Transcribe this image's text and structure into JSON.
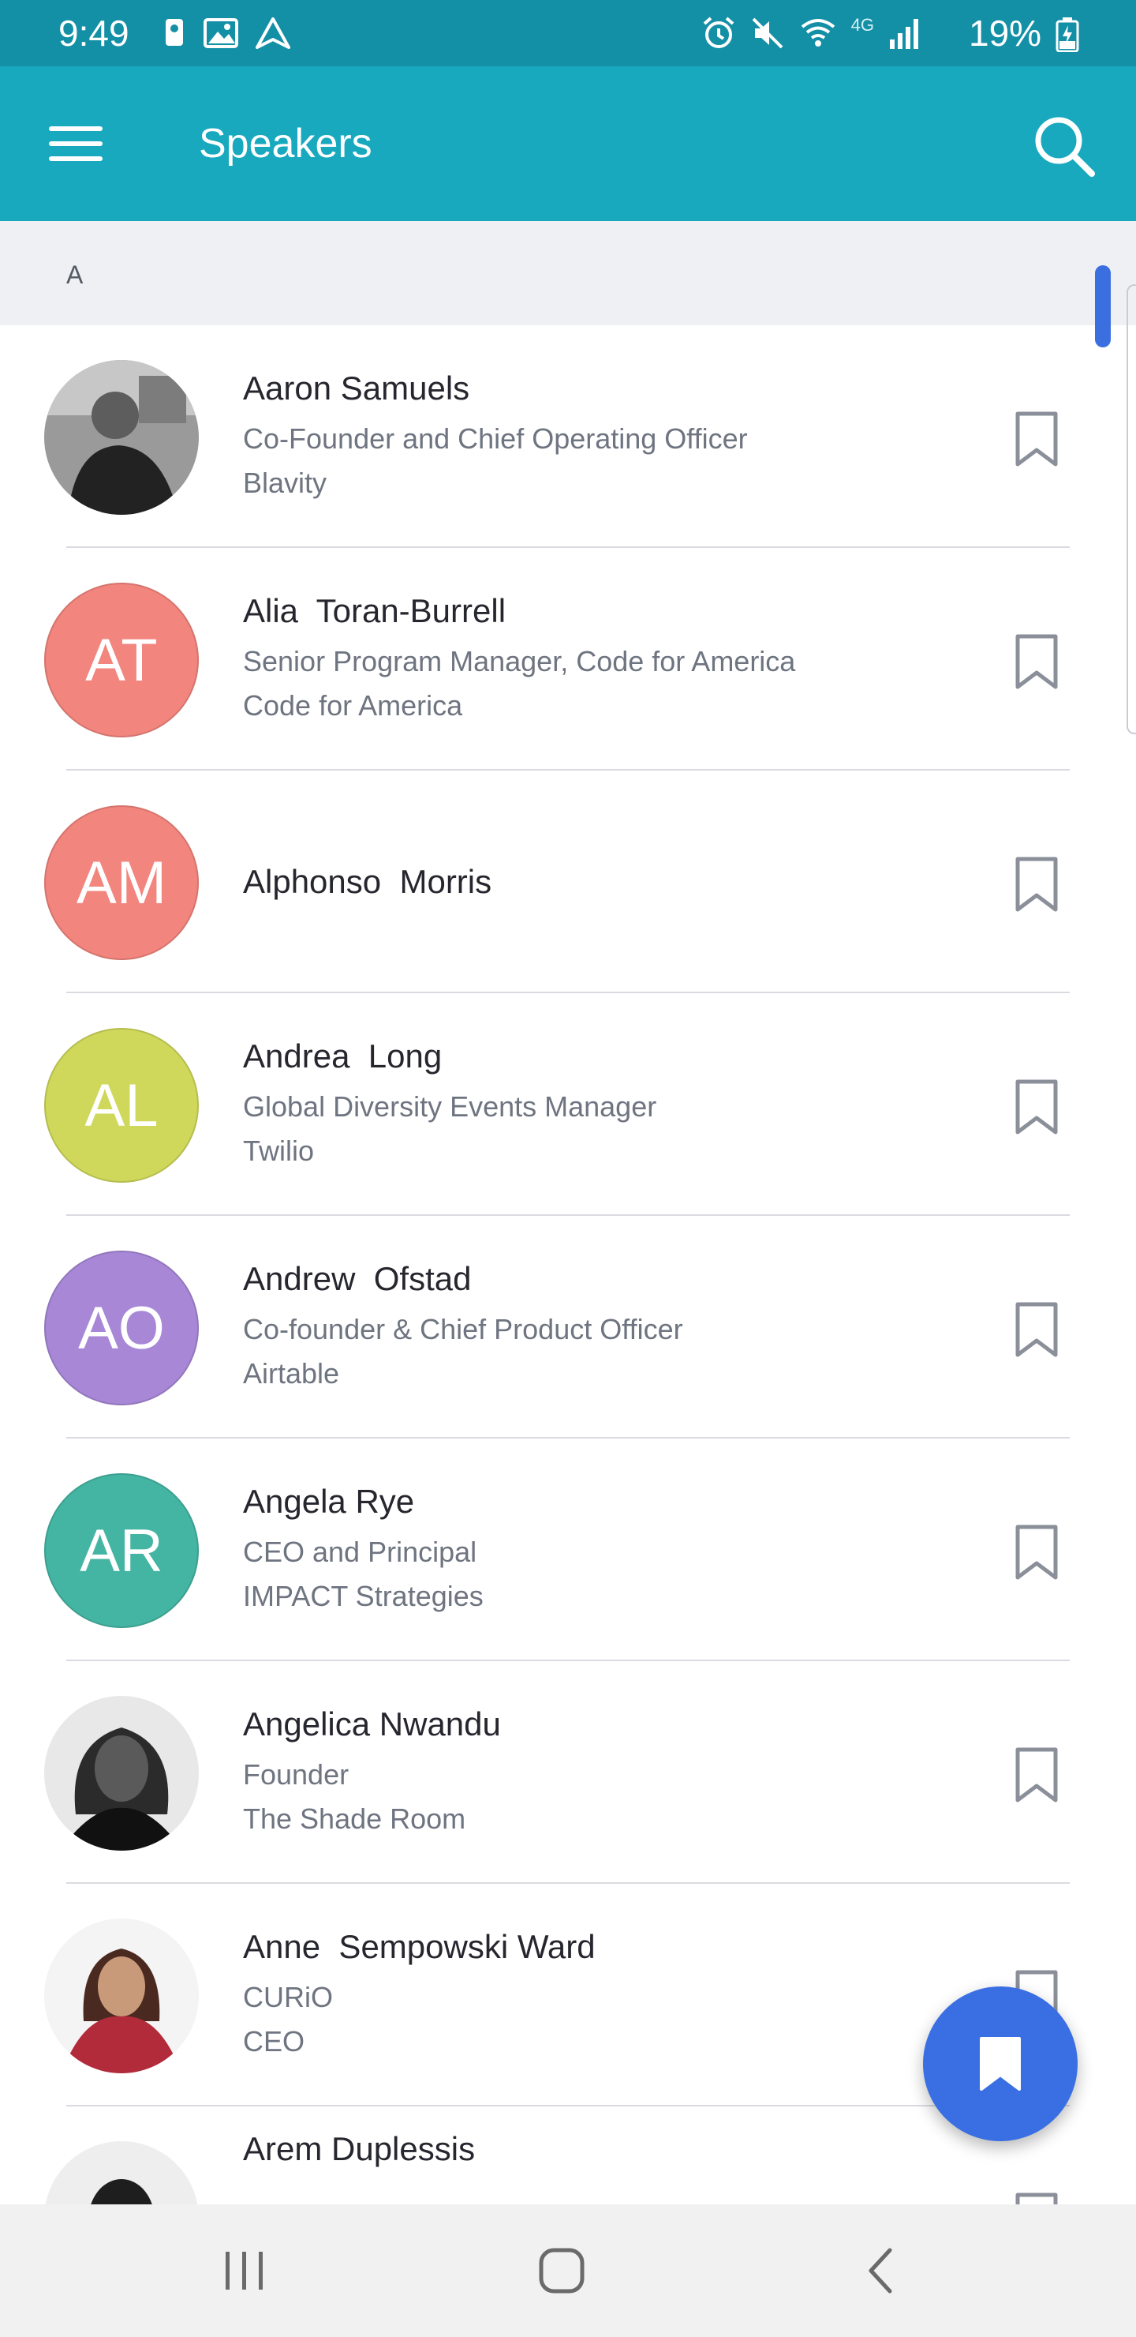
{
  "status_bar": {
    "time": "9:49",
    "left_icons": [
      "location-pin-icon",
      "image-icon",
      "navigation-icon"
    ],
    "right_icons": [
      "alarm-icon",
      "mute-icon",
      "wifi-icon",
      "signal-icon"
    ],
    "network_label": "4G",
    "battery": "19%"
  },
  "app_bar": {
    "title": "Speakers",
    "background": "#18a9bf"
  },
  "section": {
    "letter": "A"
  },
  "speakers": [
    {
      "name": "Aaron Samuels",
      "line1": "Co-Founder and Chief Operating Officer",
      "line2": "Blavity",
      "initials": "",
      "photo": true,
      "color": "#555555"
    },
    {
      "name": "Alia  Toran-Burrell",
      "line1": "Senior Program Manager, Code for America",
      "line2": "Code for America",
      "initials": "AT",
      "photo": false,
      "color": "#f2857d"
    },
    {
      "name": "Alphonso  Morris",
      "line1": "",
      "line2": "",
      "initials": "AM",
      "photo": false,
      "color": "#f2857d"
    },
    {
      "name": "Andrea  Long",
      "line1": "Global Diversity Events Manager",
      "line2": "Twilio",
      "initials": "AL",
      "photo": false,
      "color": "#cfd85a"
    },
    {
      "name": "Andrew  Ofstad",
      "line1": "Co-founder & Chief Product Officer",
      "line2": "Airtable",
      "initials": "AO",
      "photo": false,
      "color": "#a787d6"
    },
    {
      "name": "Angela Rye",
      "line1": "CEO and Principal",
      "line2": "IMPACT Strategies",
      "initials": "AR",
      "photo": false,
      "color": "#45b5a3"
    },
    {
      "name": "Angelica Nwandu",
      "line1": "Founder",
      "line2": "The Shade Room",
      "initials": "",
      "photo": true,
      "color": "#3a3a3a"
    },
    {
      "name": "Anne  Sempowski Ward",
      "line1": "CURiO",
      "line2": "CEO",
      "initials": "",
      "photo": true,
      "color": "#b12b3a"
    },
    {
      "name": "Arem Duplessis",
      "line1": "",
      "line2": "",
      "initials": "",
      "photo": true,
      "color": "#1e1e1e"
    }
  ],
  "fab": {
    "icon": "bookmark-icon",
    "color": "#3a6fe3"
  },
  "nav_bar": {
    "buttons": [
      "recent-apps-icon",
      "home-icon",
      "back-icon"
    ]
  }
}
